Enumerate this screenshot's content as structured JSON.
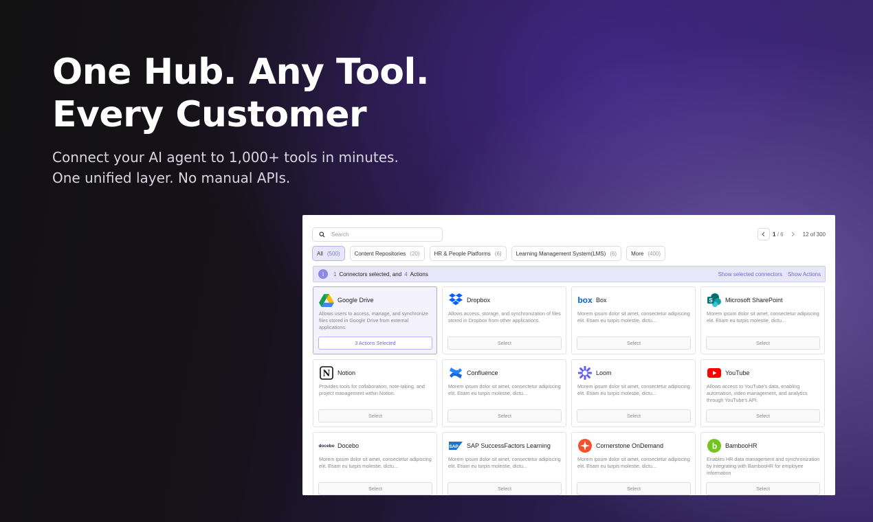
{
  "hero": {
    "title": "One Hub. Any Tool. Every Customer",
    "subtitle_line1": "Connect your AI agent to 1,000+ tools in minutes.",
    "subtitle_line2": "One unified layer. No manual APIs."
  },
  "search": {
    "placeholder": "Search",
    "icon": "search-icon"
  },
  "pager": {
    "current": "1",
    "separator": "/",
    "total": "6",
    "count": "12 of 300"
  },
  "tabs": [
    {
      "label": "All",
      "count": "(500)",
      "active": true
    },
    {
      "label": "Content Repositories",
      "count": "(20)"
    },
    {
      "label": "HR & People Platforms",
      "count": "(6)"
    },
    {
      "label": "Learning Management System(LMS)",
      "count": "(6)"
    },
    {
      "label": "More",
      "count": "(400)"
    }
  ],
  "banner": {
    "connectors_count": "1",
    "connectors_text": "Connectors selected, and",
    "actions_count": "4",
    "actions_text": "Actions",
    "link_connectors": "Show selected connectors",
    "link_actions": "Show Actions"
  },
  "cards": [
    {
      "name": "Google Drive",
      "icon": "google-drive-icon",
      "desc": "Allows users to access, manage, and synchronize files stored in Google Drive from external applications.",
      "action": "3 Actions Selected",
      "selected": true
    },
    {
      "name": "Dropbox",
      "icon": "dropbox-icon",
      "desc": "Allows access, storage, and synchronization of files stored in Dropbox from other applications.",
      "action": "Select"
    },
    {
      "name": "Box",
      "icon": "box-icon",
      "desc": "Morem ipsum dolor sit amet, consectetur adipiscing elit. Etiam eu turpis molestie, dictu...",
      "action": "Select"
    },
    {
      "name": "Microsoft SharePoint",
      "icon": "sharepoint-icon",
      "desc": "Morem ipsum dolor sit amet, consectetur adipiscing elit. Etiam eu turpis molestie, dictu...",
      "action": "Select"
    },
    {
      "name": "Notion",
      "icon": "notion-icon",
      "desc": "Provides tools for collaboration, note-taking, and project management within Notion.",
      "action": "Select"
    },
    {
      "name": "Confluence",
      "icon": "confluence-icon",
      "desc": "Morem ipsum dolor sit amet, consectetur adipiscing elit. Etiam eu turpis molestie, dictu...",
      "action": "Select"
    },
    {
      "name": "Loom",
      "icon": "loom-icon",
      "desc": "Morem ipsum dolor sit amet, consectetur adipiscing elit. Etiam eu turpis molestie, dictu...",
      "action": "Select"
    },
    {
      "name": "YouTube",
      "icon": "youtube-icon",
      "desc": "Allows access to YouTube's data, enabling automation, video management, and analytics through YouTube's API.",
      "action": "Select"
    },
    {
      "name": "Docebo",
      "icon": "docebo-icon",
      "desc": "Morem ipsum dolor sit amet, consectetur adipiscing elit. Etiam eu turpis molestie, dictu...",
      "action": "Select"
    },
    {
      "name": "SAP SuccessFactors Learning",
      "icon": "sap-icon",
      "desc": "Morem ipsum dolor sit amet, consectetur adipiscing elit. Etiam eu turpis molestie, dictu...",
      "action": "Select"
    },
    {
      "name": "Cornerstone OnDemand",
      "icon": "cornerstone-icon",
      "desc": "Morem ipsum dolor sit amet, consectetur adipiscing elit. Etiam eu turpis molestie, dictu...",
      "action": "Select"
    },
    {
      "name": "BambooHR",
      "icon": "bamboohr-icon",
      "desc": "Enables HR data management and synchronization by integrating with BambooHR for employee information",
      "action": "Select"
    }
  ],
  "colors": {
    "accent": "#6f6ad8",
    "accent_bg": "#e8e6fb"
  },
  "logo_text": {
    "box": "box",
    "docebo": "docebo",
    "sap": "SAP",
    "notion": "N",
    "bamboo": "b"
  }
}
